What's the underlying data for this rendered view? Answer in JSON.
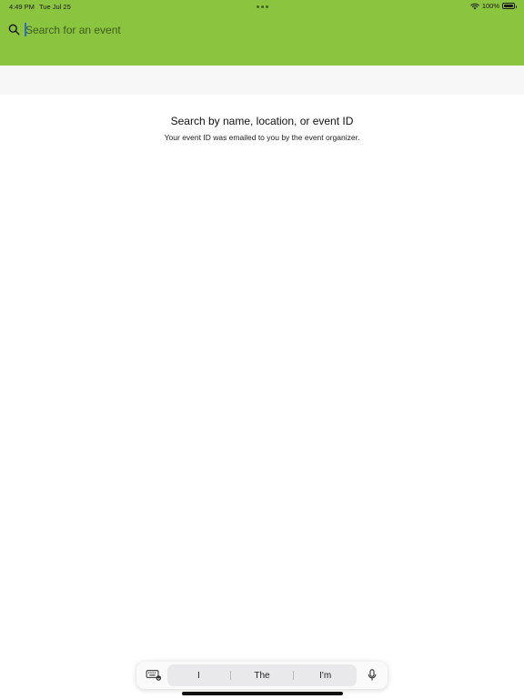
{
  "status_bar": {
    "time": "4:49 PM",
    "date": "Tue Jul 25",
    "battery": "100%"
  },
  "search": {
    "placeholder": "Search for an event",
    "value": ""
  },
  "empty_state": {
    "title": "Search by name, location, or event ID",
    "subtitle": "Your event ID was emailed to you by the event organizer."
  },
  "keyboard": {
    "suggestions": [
      "I",
      "The",
      "I'm"
    ]
  },
  "colors": {
    "header": "#8bc53f",
    "subbar": "#f7f7f7",
    "caret": "#2f6ad9"
  }
}
